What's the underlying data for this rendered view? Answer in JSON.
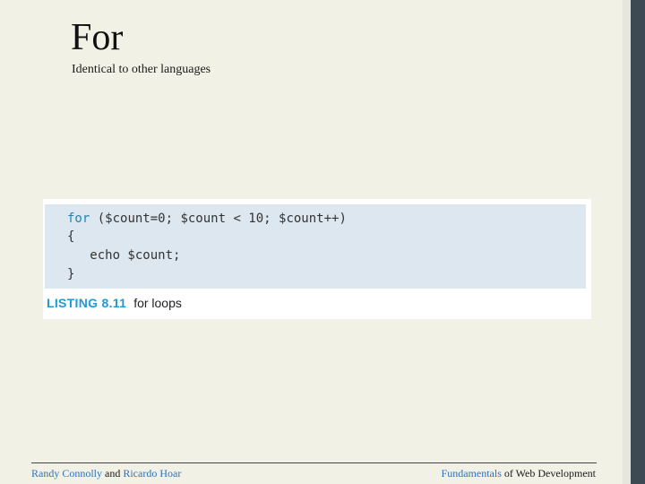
{
  "slide": {
    "title": "For",
    "subtitle": "Identical to other languages"
  },
  "listing": {
    "code": {
      "line1": {
        "keyword": "for",
        "rest": " ($count=0; $count < 10; $count++)"
      },
      "line2": "{",
      "line3": "   echo $count;",
      "line4": "}"
    },
    "caption_label": "LISTING 8.11",
    "caption_text": "for loops"
  },
  "footer": {
    "left": {
      "author1": "Randy Connolly",
      "and": " and ",
      "author2": "Ricardo Hoar"
    },
    "right": {
      "part1": "Fundamentals",
      "part2": " of Web Development"
    }
  },
  "colors": {
    "background": "#f2f1e6",
    "code_background": "#dce7f0",
    "keyword": "#1c86b8",
    "caption_label": "#1c9ad6",
    "footer_accent": "#2e72b8",
    "side_bar": "#3b4a53"
  }
}
